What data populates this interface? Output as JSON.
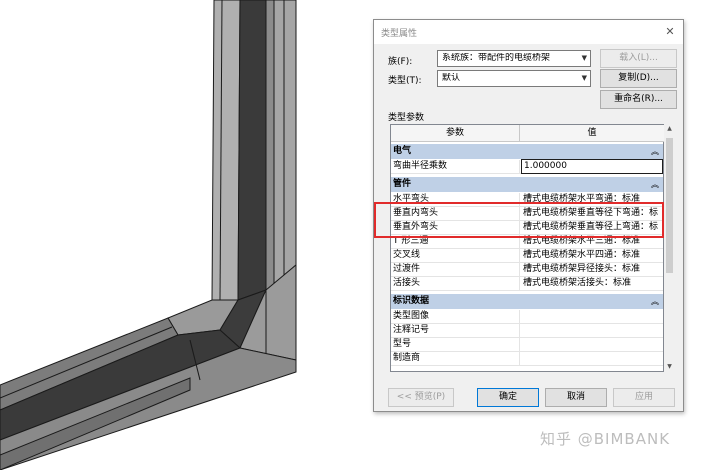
{
  "dialog": {
    "title": "类型属性",
    "close_glyph": "✕",
    "family_label": "族(F):",
    "family_value": "系统族：带配件的电缆桥架",
    "load_button": "载入(L)...",
    "type_label": "类型(T):",
    "type_value": "默认",
    "duplicate_button": "复制(D)...",
    "rename_button": "重命名(R)...",
    "type_params_label": "类型参数",
    "col_param": "参数",
    "col_value": "值",
    "groups": {
      "electrical": "电气",
      "fittings": "管件",
      "identity": "标识数据"
    },
    "rows": {
      "bend_radius": {
        "name": "弯曲半径乘数",
        "value": "1.000000"
      },
      "horizontal_bend": {
        "name": "水平弯头",
        "value": "槽式电缆桥架水平弯通：标准"
      },
      "vertical_inside_bend": {
        "name": "垂直内弯头",
        "value": "槽式电缆桥架垂直等径下弯通：标"
      },
      "vertical_outside_bend": {
        "name": "垂直外弯头",
        "value": "槽式电缆桥架垂直等径上弯通：标"
      },
      "tee": {
        "name": "T 形三通",
        "value": "槽式电缆桥架水平三通：标准"
      },
      "cross": {
        "name": "交叉线",
        "value": "槽式电缆桥架水平四通：标准"
      },
      "transition": {
        "name": "过渡件",
        "value": "槽式电缆桥架异径接头：标准"
      },
      "union": {
        "name": "活接头",
        "value": "槽式电缆桥架活接头：标准"
      },
      "type_image": {
        "name": "类型图像",
        "value": ""
      },
      "keynote": {
        "name": "注释记号",
        "value": ""
      },
      "model": {
        "name": "型号",
        "value": ""
      },
      "manufacturer": {
        "name": "制造商",
        "value": ""
      }
    },
    "preview_button": "<< 预览(P)",
    "ok_button": "确定",
    "cancel_button": "取消",
    "apply_button": "应用"
  },
  "watermark": "知乎 @BIMBANK",
  "colors": {
    "group_header": "#bfd0e6",
    "highlight": "#e12b2b",
    "tray_top": "#4a4a4a",
    "tray_side": "#8c8c8c",
    "tray_floor": "#3a3a3a"
  }
}
